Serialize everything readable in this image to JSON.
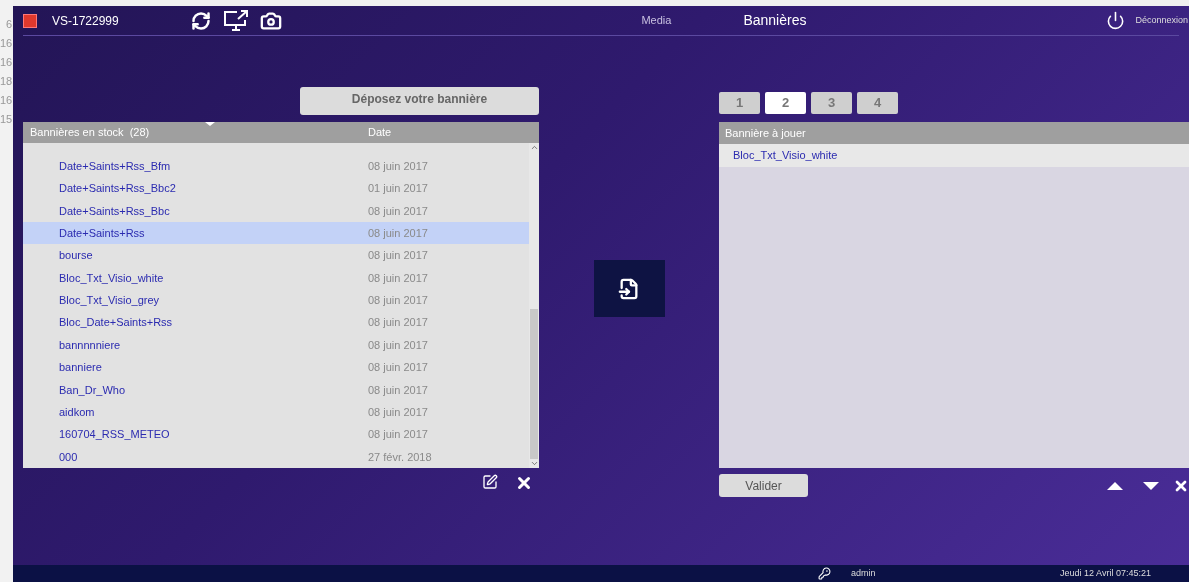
{
  "background_window": {
    "numbers": [
      "6",
      "16",
      "16",
      "18",
      "16",
      "15"
    ]
  },
  "header": {
    "device": "VS-1722999",
    "nav": [
      {
        "label": "Media",
        "selected": false
      },
      {
        "label": "Bannières",
        "selected": true
      }
    ],
    "logout": "Déconnexion"
  },
  "stock": {
    "drop_button": "Déposez votre bannière",
    "columns": [
      "Bannières en stock  (28)",
      "Date"
    ],
    "rows": [
      {
        "name": "Date+Saints+Rss_Bfm",
        "date": "08 juin 2017",
        "selected": false
      },
      {
        "name": "Date+Saints+Rss_Bbc2",
        "date": "01 juin 2017",
        "selected": false
      },
      {
        "name": "Date+Saints+Rss_Bbc",
        "date": "08 juin 2017",
        "selected": false
      },
      {
        "name": "Date+Saints+Rss",
        "date": "08 juin 2017",
        "selected": true
      },
      {
        "name": "bourse",
        "date": "08 juin 2017",
        "selected": false
      },
      {
        "name": "Bloc_Txt_Visio_white",
        "date": "08 juin 2017",
        "selected": false
      },
      {
        "name": "Bloc_Txt_Visio_grey",
        "date": "08 juin 2017",
        "selected": false
      },
      {
        "name": "Bloc_Date+Saints+Rss",
        "date": "08 juin 2017",
        "selected": false
      },
      {
        "name": "bannnnniere",
        "date": "08 juin 2017",
        "selected": false
      },
      {
        "name": "banniere",
        "date": "08 juin 2017",
        "selected": false
      },
      {
        "name": "Ban_Dr_Who",
        "date": "08 juin 2017",
        "selected": false
      },
      {
        "name": "aidkom",
        "date": "08 juin 2017",
        "selected": false
      },
      {
        "name": "160704_RSS_METEO",
        "date": "08 juin 2017",
        "selected": false
      },
      {
        "name": "000",
        "date": "27 févr. 2018",
        "selected": false
      }
    ]
  },
  "playlist": {
    "tabs": [
      {
        "label": "1",
        "selected": false
      },
      {
        "label": "2",
        "selected": true
      },
      {
        "label": "3",
        "selected": false
      },
      {
        "label": "4",
        "selected": false
      }
    ],
    "column": "Bannière à jouer",
    "rows": [
      "Bloc_Txt_Visio_white"
    ],
    "validate_button": "Valider"
  },
  "status_bar": {
    "user": "admin",
    "datetime": "Jeudi 12 Avril 07:45:21"
  }
}
